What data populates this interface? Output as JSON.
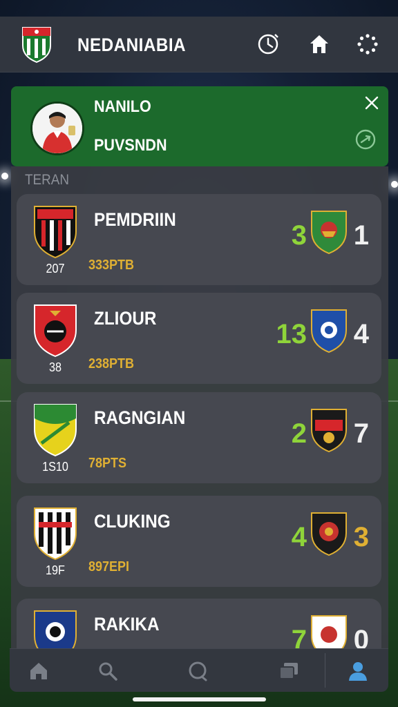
{
  "header": {
    "app_title": "NEDANIABIA",
    "icons": [
      "clock-icon",
      "home-icon",
      "loading-icon"
    ]
  },
  "notification": {
    "name": "NANILO",
    "subtitle": "PUVSNDN",
    "icons": [
      "close-icon",
      "refresh-icon"
    ]
  },
  "list": {
    "section_label": "TERAN",
    "matches": [
      {
        "team": "PEMDRIIN",
        "num": "207",
        "stat": "333PTB",
        "score_left": "3",
        "score_right": "1",
        "score_right_color": "#f0f0f0"
      },
      {
        "team": "ZLIOUR",
        "num": "38",
        "stat": "238PTB",
        "score_left": "13",
        "score_right": "4",
        "score_right_color": "#f0f0f0"
      },
      {
        "team": "RAGNGIAN",
        "num": "1S10",
        "stat": "78PTS",
        "score_left": "2",
        "score_right": "7",
        "score_right_color": "#f0f0f0"
      },
      {
        "team": "CLUKING",
        "num": "19F",
        "stat": "897EPI",
        "score_left": "4",
        "score_right": "3",
        "score_right_color": "#e0b033"
      },
      {
        "team": "RAKIKA",
        "num": "",
        "stat": "",
        "score_left": "7",
        "score_right": "0",
        "score_right_color": "#f0f0f0"
      }
    ]
  },
  "bottom_nav": {
    "icons": [
      "home-icon",
      "search-icon",
      "chat-icon",
      "cards-icon",
      "profile-icon"
    ],
    "active": "profile-icon",
    "active_color": "#4a9ee0"
  },
  "colors": {
    "header_bg": "#31363f",
    "notification_bg": "#1c6a2c",
    "card_bg": "#464850",
    "score_green": "#8fd43a",
    "stat_gold": "#e0b033"
  }
}
